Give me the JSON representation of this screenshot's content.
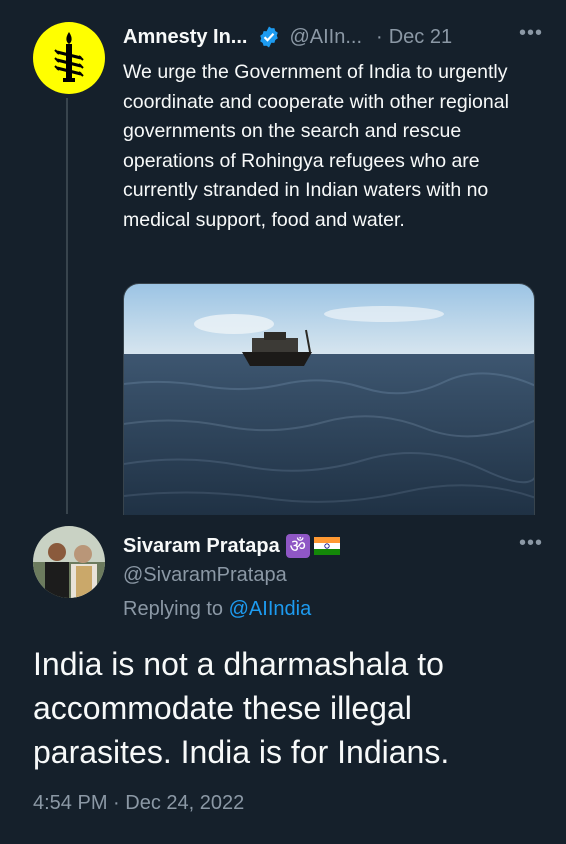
{
  "original_tweet": {
    "name": "Amnesty In...",
    "handle": "@AIIn...",
    "separator": "·",
    "date": "Dec 21",
    "more": "•••",
    "text": "We urge the Government of India to urgently coordinate and cooperate with other regional governments on the search and rescue operations of Rohingya refugees who are currently stranded in Indian waters with no medical support, food and water."
  },
  "reply_tweet": {
    "name": "Sivaram Pratapa",
    "emoji_om": "ॐ",
    "handle": "@SivaramPratapa",
    "more": "•••",
    "replying_prefix": "Replying to",
    "replying_to": "@AIIndia",
    "text": "India is not a dharmashala to accommodate these illegal parasites. India is for Indians.",
    "timestamp": "4:54 PM · Dec 24, 2022"
  },
  "colors": {
    "background": "#15202b",
    "text_primary": "#f7f9f9",
    "text_secondary": "#8b98a5",
    "link": "#1d9bf0",
    "amnesty_yellow": "#ffff00"
  }
}
